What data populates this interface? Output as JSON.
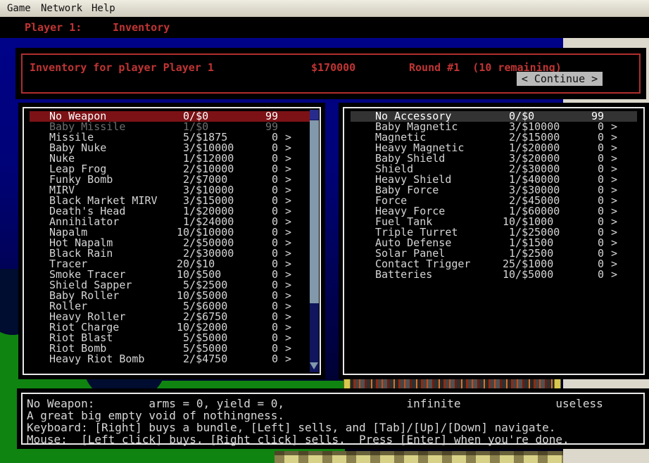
{
  "menu": {
    "items": [
      "Game",
      "Network",
      "Help"
    ]
  },
  "title_bar": {
    "player": "Player 1:",
    "screen": "Inventory"
  },
  "header": {
    "title": "Inventory for player Player 1",
    "money": "$170000",
    "round": "Round #1  (10 remaining)",
    "continue_label": "< Continue >"
  },
  "weapons": {
    "rows": [
      {
        "name": "No Weapon",
        "price": " 0/$0",
        "count": "99",
        "arrow": "",
        "state": "selected"
      },
      {
        "name": "Baby Missile",
        "price": " 1/$0",
        "count": "99",
        "arrow": "",
        "state": "dim"
      },
      {
        "name": "Missile",
        "price": " 5/$1875",
        "count": " 0",
        "arrow": ">",
        "state": "normal"
      },
      {
        "name": "Baby Nuke",
        "price": " 3/$10000",
        "count": " 0",
        "arrow": ">",
        "state": "normal"
      },
      {
        "name": "Nuke",
        "price": " 1/$12000",
        "count": " 0",
        "arrow": ">",
        "state": "normal"
      },
      {
        "name": "Leap Frog",
        "price": " 2/$10000",
        "count": " 0",
        "arrow": ">",
        "state": "normal"
      },
      {
        "name": "Funky Bomb",
        "price": " 2/$7000",
        "count": " 0",
        "arrow": ">",
        "state": "normal"
      },
      {
        "name": "MIRV",
        "price": " 3/$10000",
        "count": " 0",
        "arrow": ">",
        "state": "normal"
      },
      {
        "name": "Black Market MIRV",
        "price": " 3/$15000",
        "count": " 0",
        "arrow": ">",
        "state": "normal"
      },
      {
        "name": "Death's Head",
        "price": " 1/$20000",
        "count": " 0",
        "arrow": ">",
        "state": "normal"
      },
      {
        "name": "Annihilator",
        "price": " 1/$24000",
        "count": " 0",
        "arrow": ">",
        "state": "normal"
      },
      {
        "name": "Napalm",
        "price": "10/$10000",
        "count": " 0",
        "arrow": ">",
        "state": "normal"
      },
      {
        "name": "Hot Napalm",
        "price": " 2/$50000",
        "count": " 0",
        "arrow": ">",
        "state": "normal"
      },
      {
        "name": "Black Rain",
        "price": " 2/$30000",
        "count": " 0",
        "arrow": ">",
        "state": "normal"
      },
      {
        "name": "Tracer",
        "price": "20/$10",
        "count": " 0",
        "arrow": ">",
        "state": "normal"
      },
      {
        "name": "Smoke Tracer",
        "price": "10/$500",
        "count": " 0",
        "arrow": ">",
        "state": "normal"
      },
      {
        "name": "Shield Sapper",
        "price": " 5/$2500",
        "count": " 0",
        "arrow": ">",
        "state": "normal"
      },
      {
        "name": "Baby Roller",
        "price": "10/$5000",
        "count": " 0",
        "arrow": ">",
        "state": "normal"
      },
      {
        "name": "Roller",
        "price": " 5/$6000",
        "count": " 0",
        "arrow": ">",
        "state": "normal"
      },
      {
        "name": "Heavy Roller",
        "price": " 2/$6750",
        "count": " 0",
        "arrow": ">",
        "state": "normal"
      },
      {
        "name": "Riot Charge",
        "price": "10/$2000",
        "count": " 0",
        "arrow": ">",
        "state": "normal"
      },
      {
        "name": "Riot Blast",
        "price": " 5/$5000",
        "count": " 0",
        "arrow": ">",
        "state": "normal"
      },
      {
        "name": "Riot Bomb",
        "price": " 5/$5000",
        "count": " 0",
        "arrow": ">",
        "state": "normal"
      },
      {
        "name": "Heavy Riot Bomb",
        "price": " 2/$4750",
        "count": " 0",
        "arrow": ">",
        "state": "normal"
      }
    ]
  },
  "accessories": {
    "rows": [
      {
        "name": "No Accessory",
        "price": " 0/$0",
        "count": "99",
        "arrow": "",
        "state": "highlight"
      },
      {
        "name": "Baby Magnetic",
        "price": " 3/$10000",
        "count": " 0",
        "arrow": ">",
        "state": "normal"
      },
      {
        "name": "Magnetic",
        "price": " 2/$15000",
        "count": " 0",
        "arrow": ">",
        "state": "normal"
      },
      {
        "name": "Heavy Magnetic",
        "price": " 1/$20000",
        "count": " 0",
        "arrow": ">",
        "state": "normal"
      },
      {
        "name": "Baby Shield",
        "price": " 3/$20000",
        "count": " 0",
        "arrow": ">",
        "state": "normal"
      },
      {
        "name": "Shield",
        "price": " 2/$30000",
        "count": " 0",
        "arrow": ">",
        "state": "normal"
      },
      {
        "name": "Heavy Shield",
        "price": " 1/$40000",
        "count": " 0",
        "arrow": ">",
        "state": "normal"
      },
      {
        "name": "Baby Force",
        "price": " 3/$30000",
        "count": " 0",
        "arrow": ">",
        "state": "normal"
      },
      {
        "name": "Force",
        "price": " 2/$45000",
        "count": " 0",
        "arrow": ">",
        "state": "normal"
      },
      {
        "name": "Heavy Force",
        "price": " 1/$60000",
        "count": " 0",
        "arrow": ">",
        "state": "normal"
      },
      {
        "name": "Fuel Tank",
        "price": "10/$1000",
        "count": " 0",
        "arrow": ">",
        "state": "normal"
      },
      {
        "name": "Triple Turret",
        "price": " 1/$25000",
        "count": " 0",
        "arrow": ">",
        "state": "normal"
      },
      {
        "name": "Auto Defense",
        "price": " 1/$1500",
        "count": " 0",
        "arrow": ">",
        "state": "normal"
      },
      {
        "name": "Solar Panel",
        "price": " 1/$2500",
        "count": " 0",
        "arrow": ">",
        "state": "normal"
      },
      {
        "name": "Contact Trigger",
        "price": "25/$1000",
        "count": " 0",
        "arrow": ">",
        "state": "normal"
      },
      {
        "name": "Batteries",
        "price": "10/$5000",
        "count": " 0",
        "arrow": ">",
        "state": "normal"
      }
    ]
  },
  "footer": {
    "lines": [
      "No Weapon:        arms = 0, yield = 0,                  infinite              useless",
      "A great big empty void of nothingness.",
      "Keyboard: [Right] buys a bundle, [Left] sells, and [Tab]/[Up]/[Down] navigate.",
      "Mouse:  [Left click] buys, [Right click] sells.  Press [Enter] when you're done."
    ]
  },
  "colors": {
    "accent_red": "#c13434",
    "header_border_red": "#b02e2e",
    "selected_row_red": "#7c1216",
    "highlight_row_gray": "#333333",
    "sky_top_navy": "#000289",
    "terrain_green": "#108410",
    "window_beige": "#d6d2c6",
    "scroll_thumb_blue": "#8298ab",
    "lava_orange": "#c84c1a",
    "straw_yellow": "#d8d188"
  }
}
